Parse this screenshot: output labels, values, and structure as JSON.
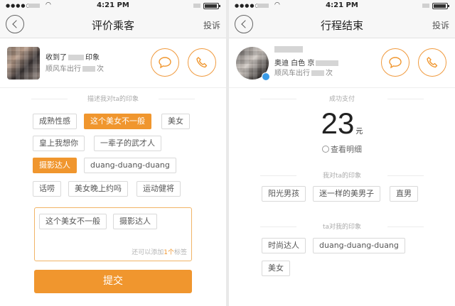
{
  "status_bar": {
    "signal": "●●●●○",
    "time": "4:21 PM"
  },
  "left": {
    "nav": {
      "title": "评价乘客",
      "right": "投诉"
    },
    "user": {
      "line1_prefix": "收到了",
      "line1_suffix": "印象",
      "line2_prefix": "顺风车出行",
      "line2_suffix": "次"
    },
    "section_label": "描述我对ta的印象",
    "tags": [
      {
        "label": "成熟性感",
        "selected": false
      },
      {
        "label": "这个美女不一般",
        "selected": true
      },
      {
        "label": "美女",
        "selected": false
      },
      {
        "label": "皇上我想你",
        "selected": false
      },
      {
        "label": "一辈子的武才人",
        "selected": false
      },
      {
        "label": "摄影达人",
        "selected": true
      },
      {
        "label": "duang-duang-duang",
        "selected": false
      },
      {
        "label": "话唠",
        "selected": false
      },
      {
        "label": "美女晚上约吗",
        "selected": false
      },
      {
        "label": "运动健将",
        "selected": false
      }
    ],
    "chosen_tags": [
      "这个美女不一般",
      "摄影达人"
    ],
    "hint_prefix": "还可以添加",
    "hint_count": "1个",
    "hint_suffix": "标签",
    "submit_label": "提交"
  },
  "right": {
    "nav": {
      "title": "行程结束",
      "right": "投诉"
    },
    "user": {
      "line1": "奥迪 白色 京",
      "line2_prefix": "顺风车出行",
      "line2_suffix": "次"
    },
    "paid_label": "成功支付",
    "amount": "23",
    "amount_unit": "元",
    "detail_label": "查看明细",
    "my_impression_label": "我对ta的印象",
    "my_tags": [
      "阳光男孩",
      "迷一样的美男子",
      "直男"
    ],
    "their_impression_label": "ta对我的印象",
    "their_tags": [
      "时尚达人",
      "duang-duang-duang",
      "美女"
    ]
  },
  "colors": {
    "accent": "#f0962e",
    "verify": "#3a9be6"
  },
  "icons": [
    "back-icon",
    "chat-bubble-icon",
    "phone-icon",
    "receipt-icon"
  ]
}
